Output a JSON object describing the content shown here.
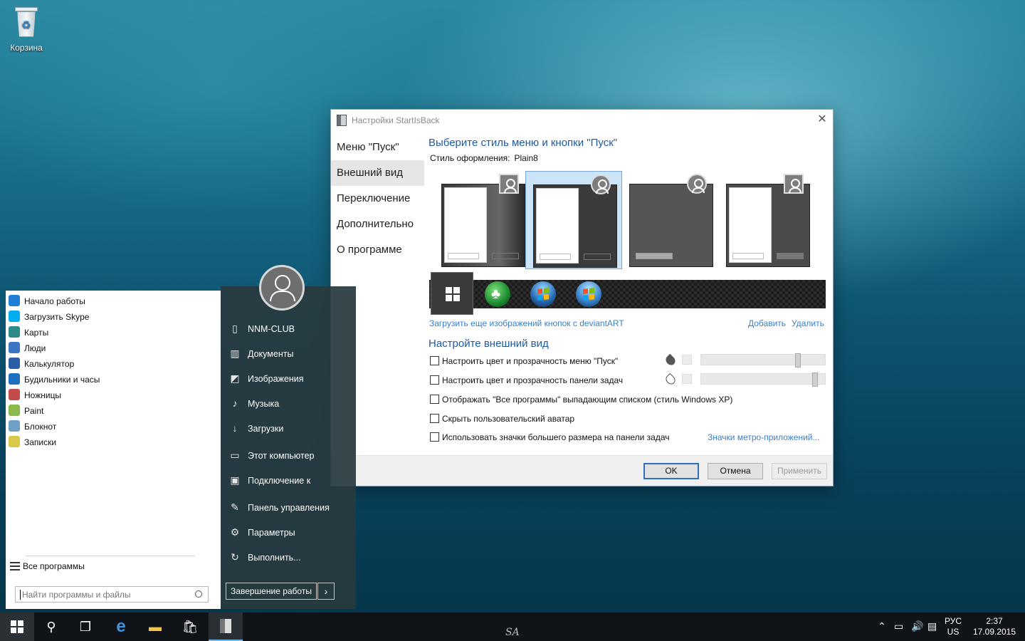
{
  "desktop": {
    "recycle_bin_label": "Корзина"
  },
  "dialog": {
    "title": "Настройки StartIsBack",
    "close_glyph": "✕",
    "nav": [
      "Меню \"Пуск\"",
      "Внешний вид",
      "Переключение",
      "Дополнительно",
      "О программе"
    ],
    "selected_nav": 1,
    "heading": "Выберите стиль меню и кнопки \"Пуск\"",
    "style_label": "Стиль оформления:",
    "style_value": "Plain8",
    "selected_thumb": 1,
    "deviant_link": "Загрузить еще изображений кнопок с deviantART",
    "add_link": "Добавить",
    "delete_link": "Удалить",
    "heading2": "Настройте внешний вид",
    "options": [
      "Настроить цвет и прозрачность меню \"Пуск\"",
      "Настроить цвет и прозрачность панели задач",
      "Отображать \"Все программы\" выпадающим списком (стиль Windows XP)",
      "Скрыть пользовательский аватар",
      "Использовать значки большего размера на панели задач"
    ],
    "slider_levels": [
      0.78,
      0.92
    ],
    "metro_link": "Значки метро-приложений...",
    "ok": "OK",
    "cancel": "Отмена",
    "apply": "Применить"
  },
  "start_menu": {
    "programs": [
      {
        "label": "Начало работы",
        "icon": "lightbulb-icon",
        "color": "#1f7fd6"
      },
      {
        "label": "Загрузить Skype",
        "icon": "skype-icon",
        "color": "#00aff0"
      },
      {
        "label": "Карты",
        "icon": "maps-icon",
        "color": "#2f8a8a"
      },
      {
        "label": "Люди",
        "icon": "people-icon",
        "color": "#3a76c4"
      },
      {
        "label": "Калькулятор",
        "icon": "calculator-icon",
        "color": "#2a5fa8"
      },
      {
        "label": "Будильники и часы",
        "icon": "clock-icon",
        "color": "#1f6fc0"
      },
      {
        "label": "Ножницы",
        "icon": "scissors-icon",
        "color": "#c44b4b"
      },
      {
        "label": "Paint",
        "icon": "paint-icon",
        "color": "#8bb94a"
      },
      {
        "label": "Блокнот",
        "icon": "notepad-icon",
        "color": "#6fa0c8"
      },
      {
        "label": "Записки",
        "icon": "sticky-notes-icon",
        "color": "#d9c84a"
      }
    ],
    "all_programs": "Все программы",
    "search_placeholder": "Найти программы и файлы",
    "places": [
      {
        "label": "NNM-CLUB",
        "glyph": "▯"
      },
      {
        "label": "Документы",
        "glyph": "▥"
      },
      {
        "label": "Изображения",
        "glyph": "◩"
      },
      {
        "label": "Музыка",
        "glyph": "♪"
      },
      {
        "label": "Загрузки",
        "glyph": "↓"
      },
      {
        "label": "Этот компьютер",
        "glyph": "▭"
      },
      {
        "label": "Подключение к",
        "glyph": "▣"
      },
      {
        "label": "Панель управления",
        "glyph": "✎"
      },
      {
        "label": "Параметры",
        "glyph": "⚙"
      },
      {
        "label": "Выполнить...",
        "glyph": "↻"
      }
    ],
    "shutdown": "Завершение работы",
    "shutdown_arrow": "›"
  },
  "taskbar": {
    "watermark": "SA",
    "lang_top": "РУС",
    "lang_bottom": "US",
    "time": "2:37",
    "date": "17.09.2015"
  }
}
